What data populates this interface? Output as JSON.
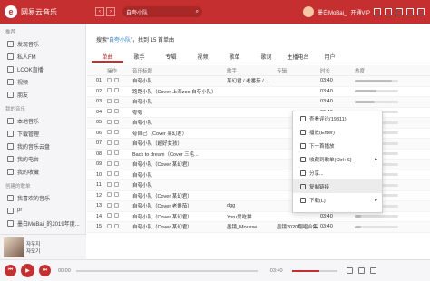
{
  "app": {
    "title": "网易云音乐",
    "logo_char": "e"
  },
  "top": {
    "search_value": "自夸小队",
    "user_name": "墨白MoBai_",
    "vip": "开通VIP"
  },
  "sidebar": {
    "section1": "推荐",
    "items": [
      "发现音乐",
      "私人FM",
      "LOOK直播",
      "视频",
      "朋友"
    ],
    "section2": "我的音乐",
    "items2": [
      "本地音乐",
      "下载管理",
      "我的音乐云盘",
      "我的电台",
      "我的收藏"
    ],
    "section3": "创建的歌单",
    "items3": [
      "我喜欢的音乐",
      "pr",
      "墨白MoBai_的2019年度..."
    ]
  },
  "now_playing": {
    "title": "자우지",
    "artist": "자모기"
  },
  "main": {
    "result_prefix": "搜索“",
    "result_keyword": "自夸小队",
    "result_suffix": "”，找到 15 首单曲",
    "tabs": [
      "单曲",
      "歌手",
      "专辑",
      "视频",
      "歌单",
      "歌词",
      "主播电台",
      "用户"
    ],
    "headers": [
      "",
      "操作",
      "音乐标题",
      "歌手",
      "专辑",
      "时长",
      "热度"
    ],
    "rows": [
      {
        "n": "01",
        "title": "自夸小队",
        "artist": "某幻君 / 老番茄 / ...",
        "album": "",
        "time": "03:40",
        "heat": 0.85
      },
      {
        "n": "02",
        "title": "路路小队（Cover 上海zoo 自夸小队）",
        "artist": "",
        "album": "",
        "time": "03:40",
        "heat": 0.5
      },
      {
        "n": "03",
        "title": "自夸小队",
        "artist": "",
        "album": "",
        "time": "03:40",
        "heat": 0.45
      },
      {
        "n": "04",
        "title": "夸夸",
        "artist": "",
        "album": "",
        "time": "03:40",
        "heat": 0.3
      },
      {
        "n": "05",
        "title": "自夸小队",
        "artist": "",
        "album": "",
        "time": "03:40",
        "heat": 0.3
      },
      {
        "n": "06",
        "title": "夸自己（Cover 某幻君）",
        "artist": "",
        "album": "",
        "time": "03:40",
        "heat": 0.25
      },
      {
        "n": "07",
        "title": "自夸小队（超好女孩）",
        "artist": "",
        "album": "",
        "time": "03:40",
        "heat": 0.25
      },
      {
        "n": "08",
        "title": "Back to dream（Cover 三毛...",
        "artist": "",
        "album": "",
        "time": "03:40",
        "heat": 0.2
      },
      {
        "n": "09",
        "title": "自夸小队（Cover 某幻君）",
        "artist": "",
        "album": "",
        "time": "03:40",
        "heat": 0.2
      },
      {
        "n": "10",
        "title": "自夸小队",
        "artist": "",
        "album": "",
        "time": "03:40",
        "heat": 0.2
      },
      {
        "n": "11",
        "title": "自夸小队",
        "artist": "",
        "album": "",
        "time": "03:40",
        "heat": 0.2
      },
      {
        "n": "12",
        "title": "自夸小队（Cover 某幻君）",
        "artist": "",
        "album": "",
        "time": "03:40",
        "heat": 0.2
      },
      {
        "n": "13",
        "title": "自夸小队（Cover 老番茄）",
        "artist": "dgg",
        "album": "",
        "time": "03:40",
        "heat": 0.15
      },
      {
        "n": "14",
        "title": "自夸小队（Cover 某幻君）",
        "artist": "Yoru爱吃猫",
        "album": "",
        "time": "03:40",
        "heat": 0.15
      },
      {
        "n": "15",
        "title": "自夸小队（Cover 某幻君）",
        "artist": "墨镜_Mousse",
        "album": "墨镜2020翻唱合集",
        "time": "03:40",
        "heat": 0.15
      }
    ]
  },
  "context_menu": [
    "查看评论(19311)",
    "播放(Enter)",
    "下一首播放",
    "收藏到歌单(Ctrl+S)",
    "分享...",
    "复制链接",
    "下载(L)"
  ],
  "player": {
    "time_current": "00:00",
    "time_total": "03:40",
    "progress": 0.0,
    "volume": 0.6
  }
}
